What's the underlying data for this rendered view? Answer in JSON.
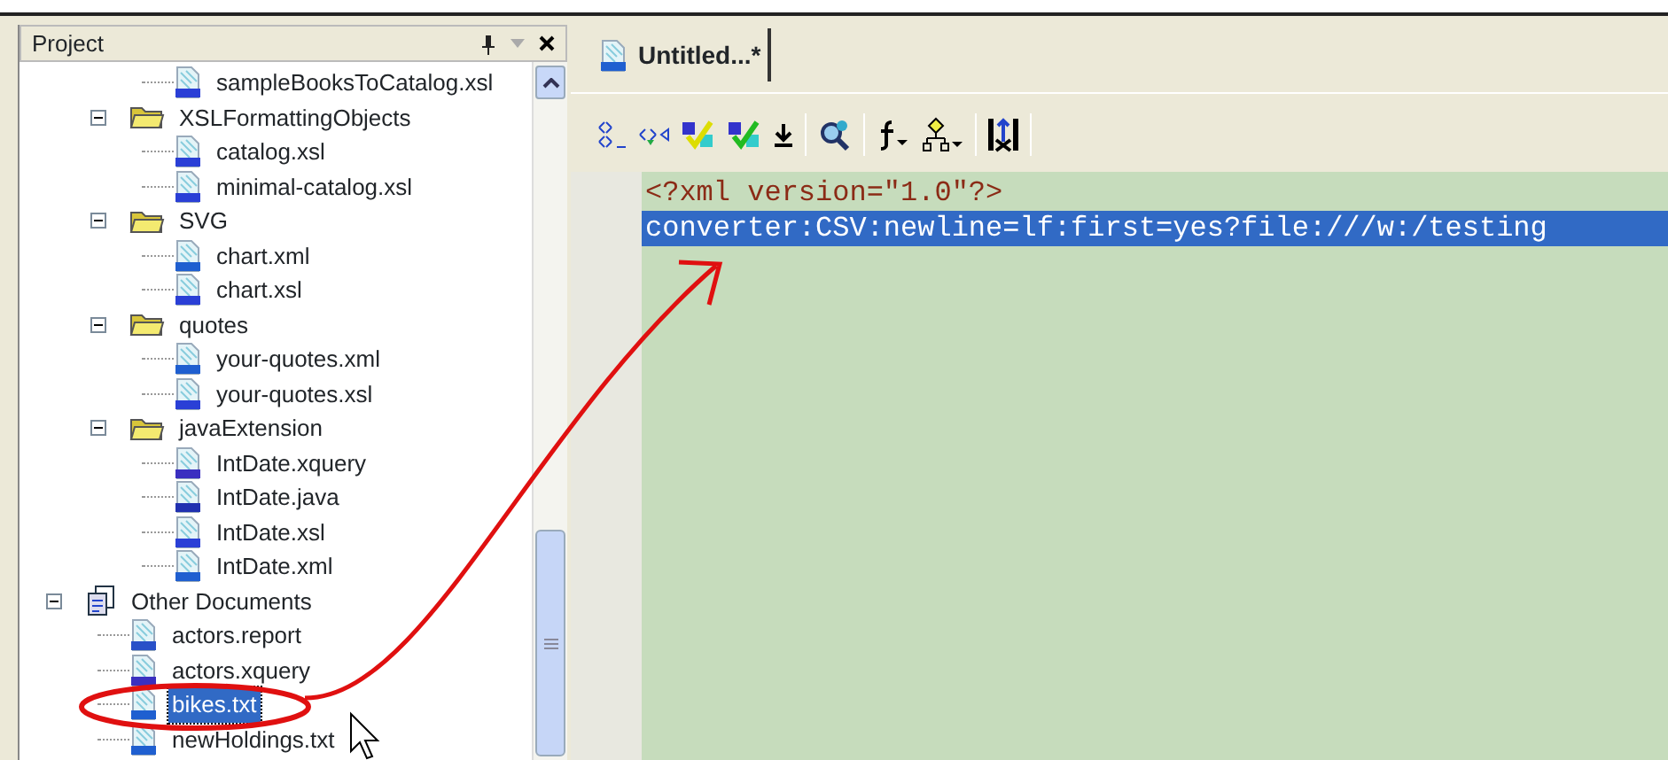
{
  "project_panel": {
    "title": "Project",
    "tree": [
      {
        "children": [
          {
            "children": [
              {
                "label": "sampleBooksToCatalog.xsl",
                "kind": "xslt",
                "selected": false
              }
            ]
          },
          {
            "label": "XSLFormattingObjects",
            "kind": "folder",
            "expanded": true,
            "children": [
              {
                "label": "catalog.xsl",
                "kind": "xslt",
                "selected": false
              },
              {
                "label": "minimal-catalog.xsl",
                "kind": "xslt",
                "selected": false
              }
            ]
          },
          {
            "label": "SVG",
            "kind": "folder",
            "expanded": true,
            "children": [
              {
                "label": "chart.xml",
                "kind": "xml",
                "selected": false
              },
              {
                "label": "chart.xsl",
                "kind": "xslt",
                "selected": false
              }
            ]
          },
          {
            "label": "quotes",
            "kind": "folder",
            "expanded": true,
            "children": [
              {
                "label": "your-quotes.xml",
                "kind": "xml",
                "selected": false
              },
              {
                "label": "your-quotes.xsl",
                "kind": "xslt",
                "selected": false
              }
            ]
          },
          {
            "label": "javaExtension",
            "kind": "folder",
            "expanded": true,
            "children": [
              {
                "label": "IntDate.xquery",
                "kind": "xquery",
                "selected": false
              },
              {
                "label": "IntDate.java",
                "kind": "java",
                "selected": false
              },
              {
                "label": "IntDate.xsl",
                "kind": "xslt",
                "selected": false
              },
              {
                "label": "IntDate.xml",
                "kind": "xml",
                "selected": false
              }
            ]
          }
        ]
      },
      {
        "label": "Other Documents",
        "kind": "documents",
        "expanded": true,
        "children": [
          {
            "label": "actors.report",
            "kind": "report",
            "selected": false
          },
          {
            "label": "actors.xquery",
            "kind": "xquery",
            "selected": false
          },
          {
            "label": "bikes.txt",
            "kind": "xml",
            "selected": true
          },
          {
            "label": "newHoldings.txt",
            "kind": "xml",
            "selected": false
          }
        ]
      }
    ]
  },
  "editor": {
    "tabs": [
      {
        "title": "Untitled...*",
        "selected": true
      }
    ],
    "lines": [
      {
        "text": "<?xml version=\"1.0\"?>",
        "selected": false
      },
      {
        "text": "converter:CSV:newline=lf:first=yes?file:///w:/testing",
        "selected": true
      }
    ]
  }
}
